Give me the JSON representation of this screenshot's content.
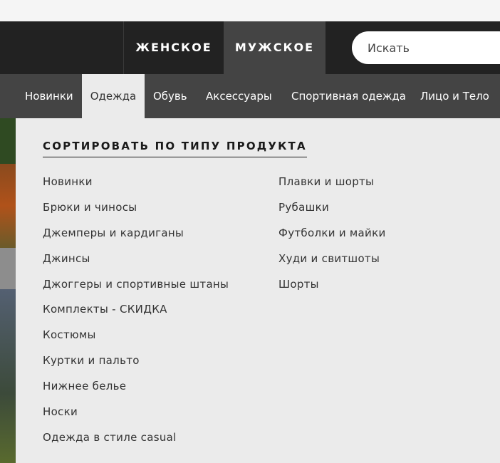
{
  "header": {
    "gender_tabs": [
      "ЖЕНСКОЕ",
      "МУЖСКОЕ"
    ],
    "active_gender": "МУЖСКОЕ",
    "search": {
      "placeholder": "Искать"
    }
  },
  "category_nav": {
    "items": [
      "Новинки",
      "Одежда",
      "Обувь",
      "Аксессуары",
      "Спортивная одежда",
      "Лицо и Тело"
    ],
    "active": "Одежда"
  },
  "dropdown": {
    "heading": "СОРТИРОВАТЬ ПО ТИПУ ПРОДУКТА",
    "column1": [
      "Новинки",
      "Брюки и чиносы",
      "Джемперы и кардиганы",
      "Джинсы",
      "Джоггеры и спортивные штаны",
      "Комплекты - СКИДКА",
      "Костюмы",
      "Куртки и пальто",
      "Нижнее белье",
      "Носки",
      "Одежда в стиле casual"
    ],
    "column2": [
      "Плавки и шорты",
      "Рубашки",
      "Футболки и майки",
      "Худи и свитшоты",
      "Шорты"
    ]
  },
  "colors": {
    "header_bg": "#222222",
    "active_gender_bg": "#444444",
    "category_nav_bg": "#444444",
    "panel_bg": "#ebebeb"
  }
}
